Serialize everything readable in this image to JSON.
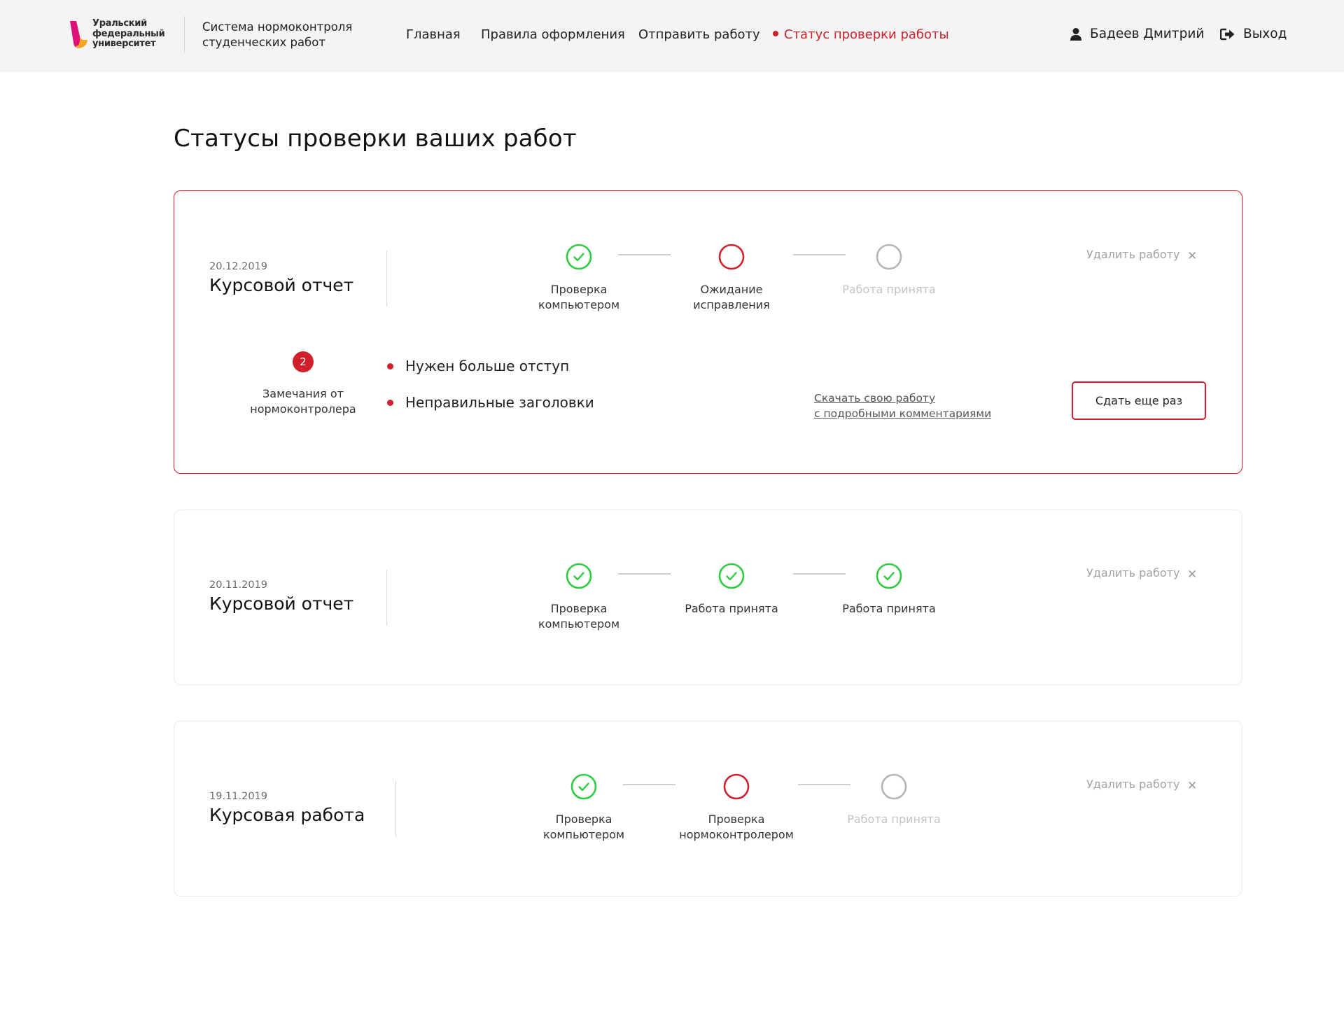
{
  "header": {
    "logo_lines": [
      "Уральский",
      "федеральный",
      "университет"
    ],
    "system_title_lines": [
      "Система нормоконтроля",
      "студенческих работ"
    ],
    "nav": [
      {
        "label": "Главная",
        "active": false
      },
      {
        "label": "Правила оформления",
        "active": false
      },
      {
        "label": "Отправить работу",
        "active": false
      },
      {
        "label": "Статус проверки работы",
        "active": true
      }
    ],
    "user_name": "Бадеев Дмитрий",
    "logout_label": "Выход"
  },
  "page_title": "Статусы проверки ваших работ",
  "works": [
    {
      "date": "20.12.2019",
      "title": "Курсовой отчет",
      "steps": [
        {
          "label_lines": [
            "Проверка",
            "компьютером"
          ],
          "status": "done"
        },
        {
          "label_lines": [
            "Ожидание",
            "исправления"
          ],
          "status": "current"
        },
        {
          "label_lines": [
            "Работа принята"
          ],
          "status": "pending"
        }
      ],
      "delete_label": "Удалить работу",
      "remarks": {
        "count": "2",
        "caption_lines": [
          "Замечания от",
          "нормоконтролера"
        ],
        "items": [
          "Нужен больше отступ",
          "Неправильные заголовки"
        ],
        "download_lines": [
          "Скачать свою работу",
          "с подробными комментариями"
        ],
        "resubmit_label": "Сдать еще раз"
      }
    },
    {
      "date": "20.11.2019",
      "title": "Курсовой отчет",
      "steps": [
        {
          "label_lines": [
            "Проверка",
            "компьютером"
          ],
          "status": "done"
        },
        {
          "label_lines": [
            "Работа принята"
          ],
          "status": "done"
        },
        {
          "label_lines": [
            "Работа принята"
          ],
          "status": "done"
        }
      ],
      "delete_label": "Удалить работу"
    },
    {
      "date": "19.11.2019",
      "title": "Курсовая работа",
      "steps": [
        {
          "label_lines": [
            "Проверка",
            "компьютером"
          ],
          "status": "done"
        },
        {
          "label_lines": [
            "Проверка",
            "нормоконтролером"
          ],
          "status": "current"
        },
        {
          "label_lines": [
            "Работа принята"
          ],
          "status": "pending"
        }
      ],
      "delete_label": "Удалить работу"
    }
  ],
  "colors": {
    "accent_red": "#d0202b",
    "success_green": "#2ecc40",
    "pending_gray": "#b5b5b5"
  },
  "icons": {
    "user": "user-icon",
    "logout": "logout-icon",
    "delete": "close-icon",
    "done": "check-circle-icon",
    "current": "empty-red-circle-icon",
    "pending": "empty-gray-circle-icon"
  }
}
